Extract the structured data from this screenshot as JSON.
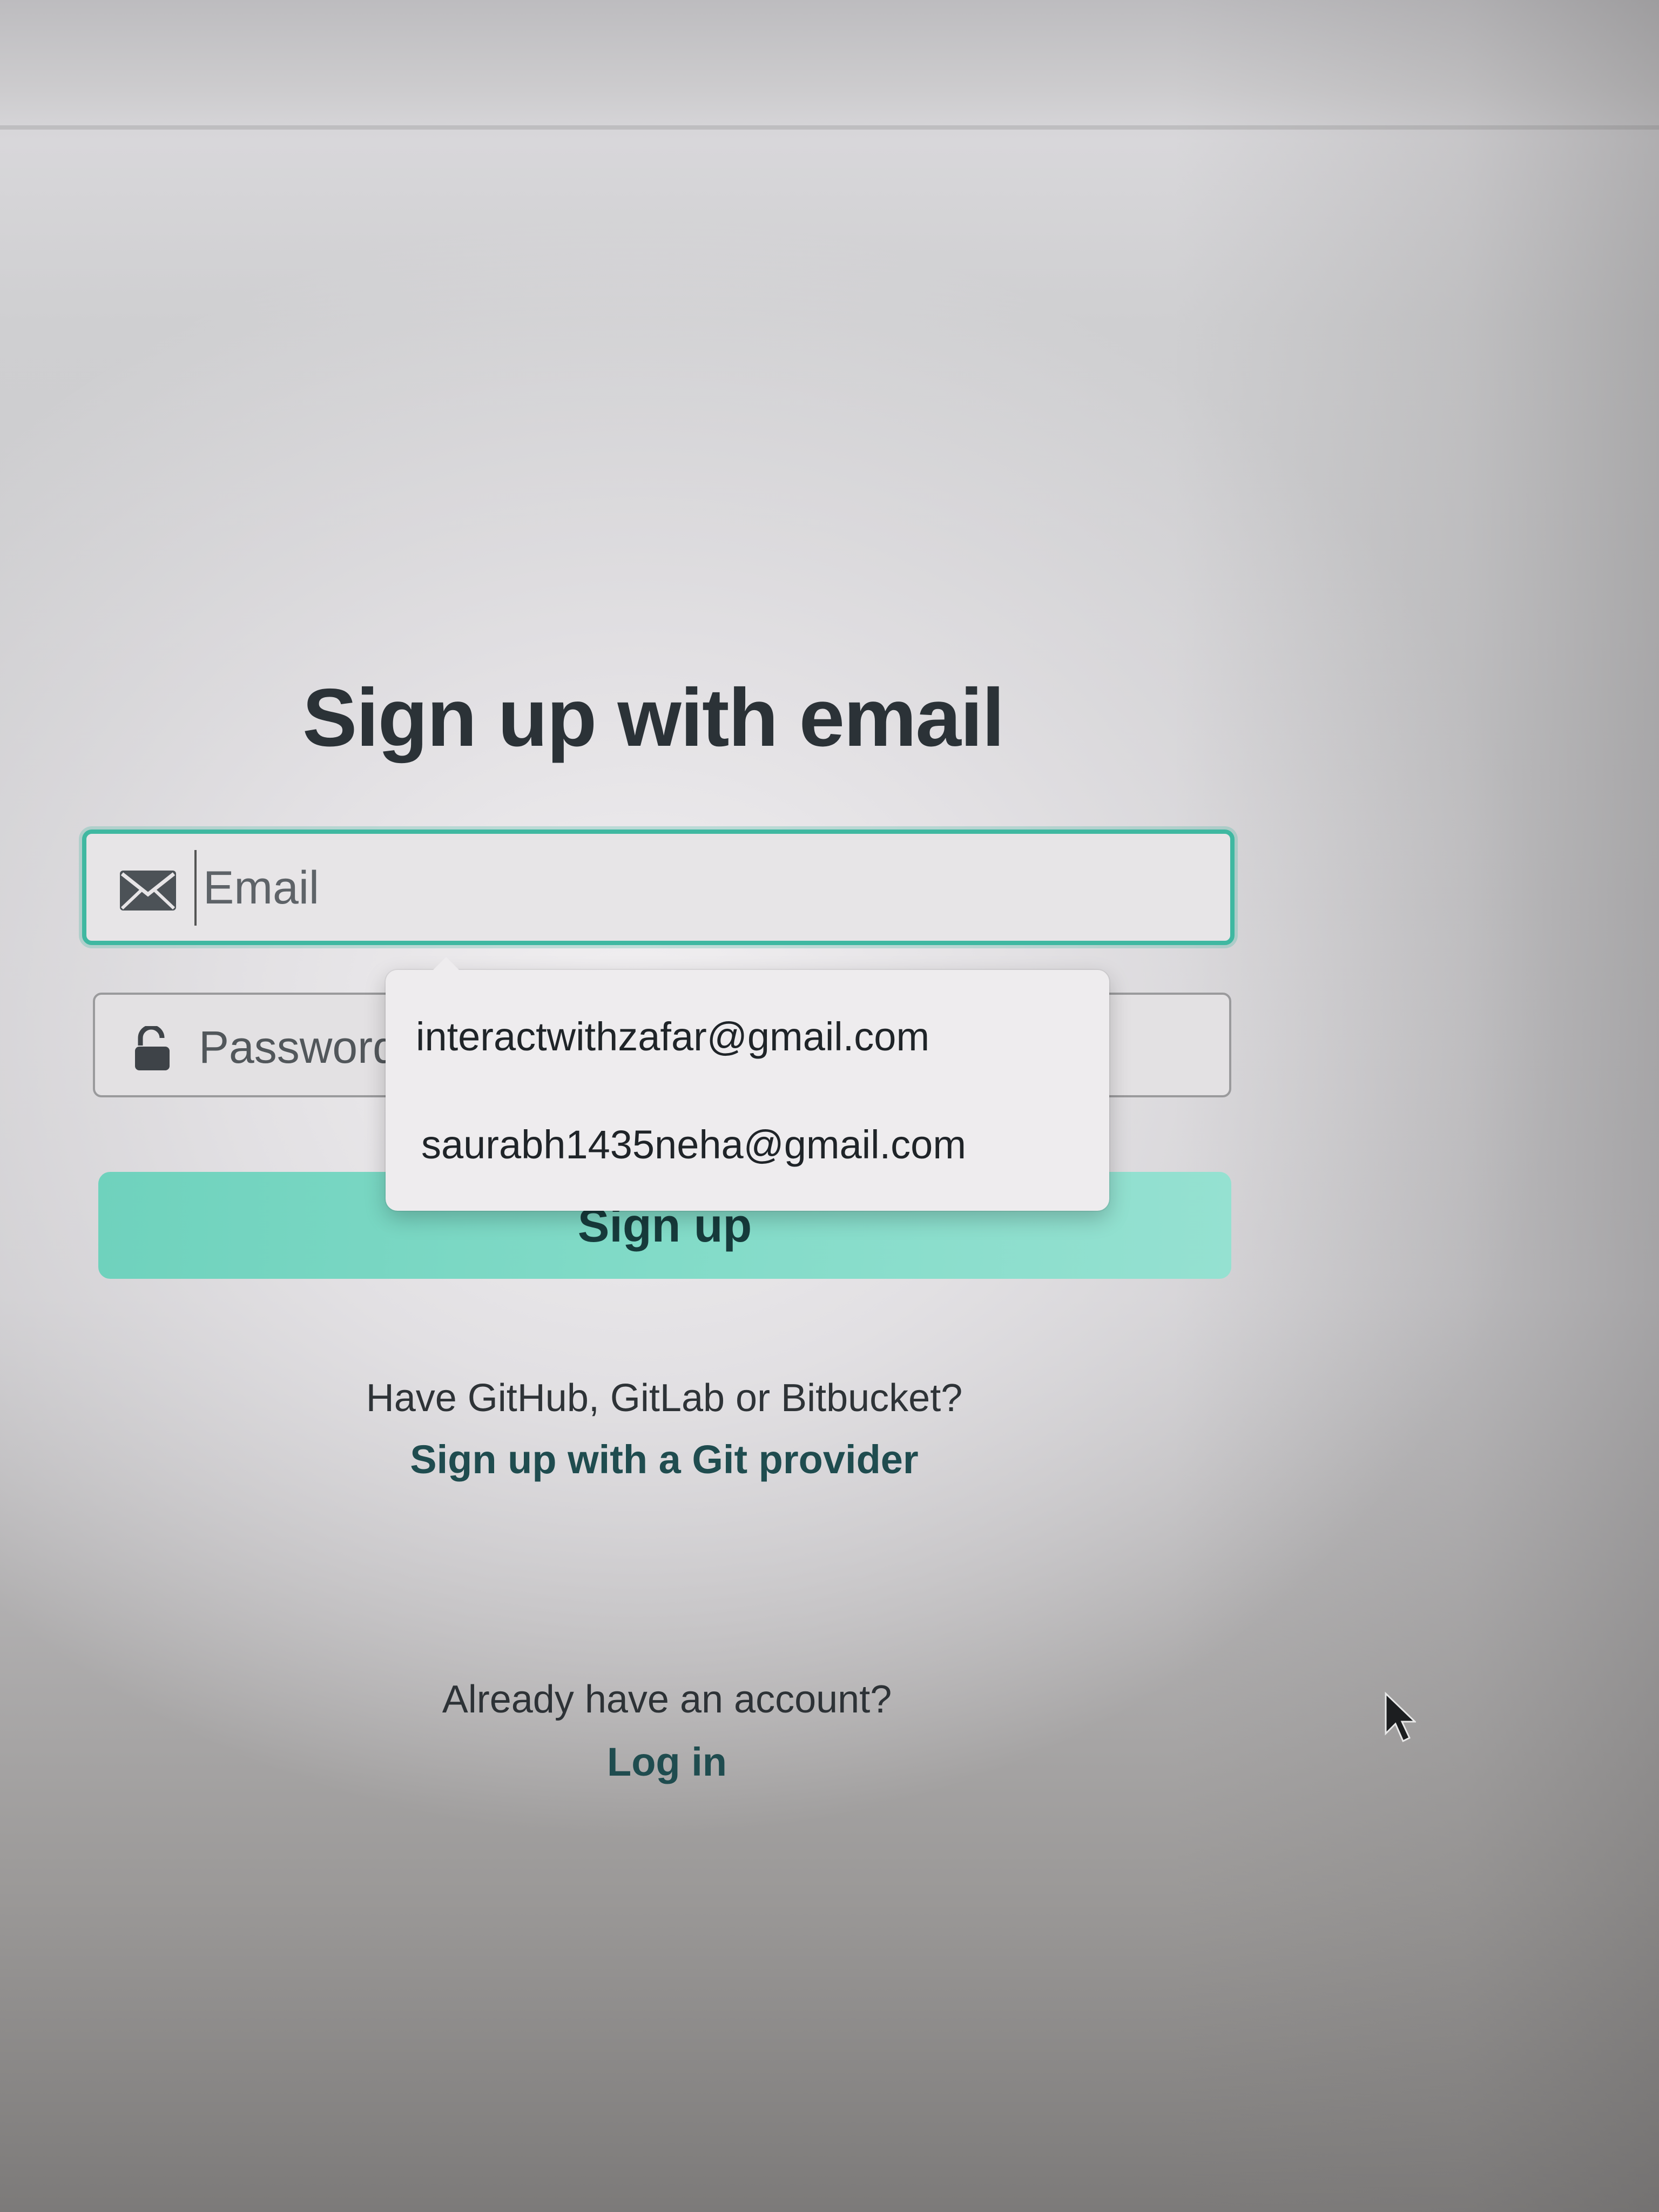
{
  "page": {
    "title": "Sign up with email"
  },
  "form": {
    "email": {
      "placeholder": "Email",
      "value": "",
      "icon": "envelope-icon"
    },
    "password": {
      "placeholder": "Password",
      "value": "",
      "icon": "lock-icon"
    },
    "submit_label": "Sign up"
  },
  "autocomplete": {
    "suggestions": [
      "interactwithzafar@gmail.com",
      "saurabh1435neha@gmail.com"
    ]
  },
  "git_provider": {
    "prompt": "Have GitHub, GitLab or Bitbucket?",
    "link_label": "Sign up with a Git provider"
  },
  "login": {
    "prompt": "Already have an account?",
    "link_label": "Log in"
  },
  "colors": {
    "accent": "#3fb8a1",
    "button": "#82dbc8",
    "link": "#1f4c4f",
    "heading": "#2b3237"
  }
}
